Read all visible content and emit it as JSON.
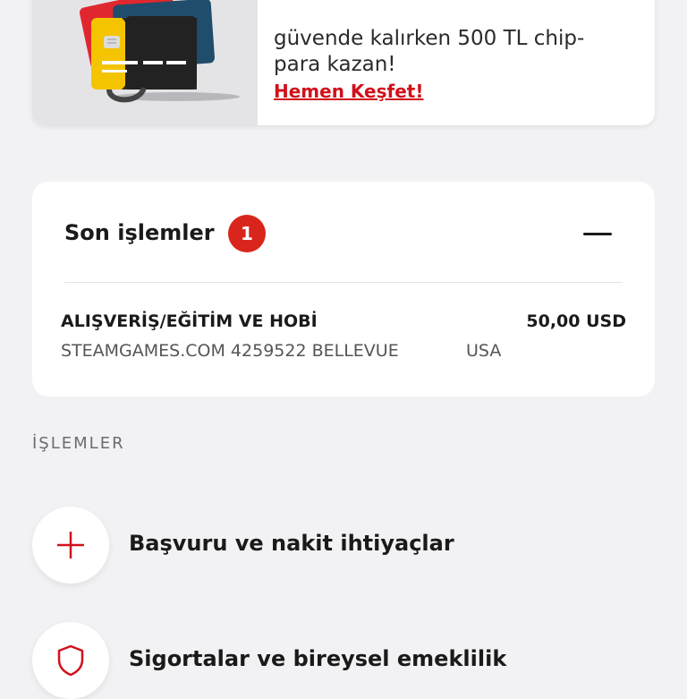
{
  "promo": {
    "line1": "güvende kalırken 500 TL chip-",
    "line2": "para kazan!",
    "link": "Hemen Keşfet!"
  },
  "recent": {
    "title": "Son işlemler",
    "badge": "1",
    "transaction": {
      "category": "ALIŞVERİŞ/EĞİTİM VE HOBİ",
      "amount": "50,00 USD",
      "merchant": "STEAMGAMES.COM 4259522 BELLEVUE",
      "country": "USA"
    }
  },
  "section": {
    "title": "İŞLEMLER"
  },
  "menu": [
    {
      "label": "Başvuru ve nakit ihtiyaçlar",
      "icon": "plus-icon"
    },
    {
      "label": "Sigortalar ve bireysel emeklilik",
      "icon": "shield-icon"
    }
  ],
  "colors": {
    "accent": "#d0111b",
    "badge": "#d9261c",
    "background": "#f2f2f4"
  }
}
